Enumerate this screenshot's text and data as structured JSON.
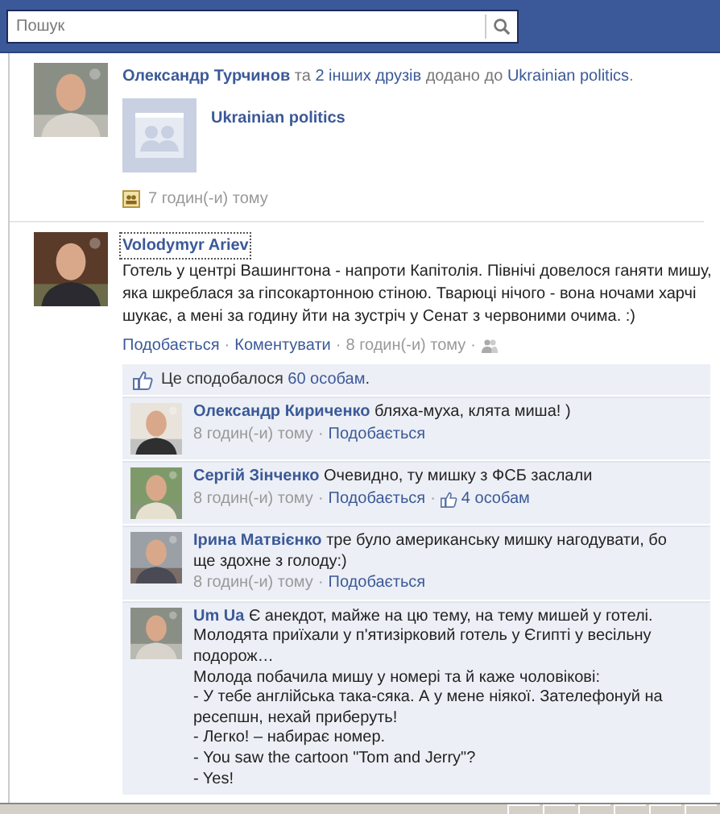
{
  "search": {
    "placeholder": "Пошук"
  },
  "story": {
    "actor": "Олександр Турчинов",
    "joiner": "та",
    "others": "2 інших друзів",
    "action": "додано до",
    "target": "Ukrainian politics",
    "suffix": ".",
    "group_name": "Ukrainian politics",
    "time": "7 годин(-и) тому"
  },
  "post": {
    "author": "Volodymyr Ariev",
    "text": "Готель у центрі Вашингтона - напроти Капітолія. Північі довелося ганяти мишу, яка шкреблася за гіпсокартонною стіною. Тварюці нічого - вона ночами харчі шукає, а мені за годину йти на зустріч у Сенат з червоними очима. :)",
    "like": "Подобається",
    "separator": "·",
    "comment": "Коментувати",
    "time": "8 годин(-и) тому",
    "likes_prefix": "Це сподобалося",
    "likes_count": "60 особам",
    "likes_suffix": "."
  },
  "comments": [
    {
      "author": "Олександр Кириченко",
      "text": "бляха-муха, клята миша! )",
      "time": "8 годин(-и) тому",
      "separator": "·",
      "like": "Подобається"
    },
    {
      "author": "Сергій Зінченко",
      "text": "Очевидно, ту мишку з ФСБ заслали",
      "time": "8 годин(-и) тому",
      "separator": "·",
      "like": "Подобається",
      "likes": "4 особам"
    },
    {
      "author": "Ірина Матвієнко",
      "text": "тре було американську мишку нагодувати, бо ще здохне з голоду:)",
      "time": "8 годин(-и) тому",
      "separator": "·",
      "like": "Подобається"
    },
    {
      "author": "Um Ua",
      "text": "Є анекдот, майже на цю тему, на тему мишей у готелі. Молодята приїхали у п'ятизірковий готель у Єгипті у весільну подорож…\nМолода побачила мишу у номері та й каже чоловікові:\n- У тебе англійська така-сяка. А у мене ніякої. Зателефонуй на ресепшн, нехай приберуть!\n- Легко! – набирає номер.\n- You saw the cartoon \"Tom and Jerry\"?\n- Yes!"
    }
  ]
}
